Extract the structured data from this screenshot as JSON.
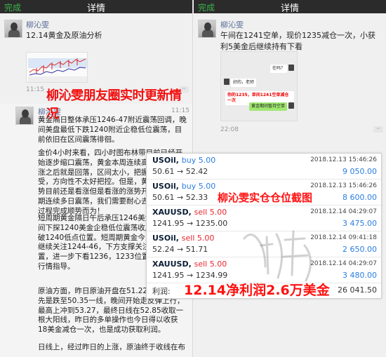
{
  "left_pane": {
    "nav": {
      "done": "完成",
      "title": "详情"
    },
    "post1": {
      "author": "柳沁雯",
      "text": "12.14黄金及原油分析",
      "time": "11:15"
    },
    "banner": "柳沁雯朋友圈实时更新情况",
    "post2": {
      "author": "柳沁雯",
      "time": "11:15",
      "paragraphs": [
        "黄金隔日整体承压1246-47附近震荡回调，晚间美盘最低下跌1240附近企稳低位震荡，目前依旧在区间震荡徘徊。",
        "金价4小时来看，四小时图布林带目前已经开始逐步缩口震荡，黄金本周连续高位小回，小涨之后就是回落，区间太小，把握起来比较难受，方向性不太好把控。但是，黄金就中期走势目前还是看涨但是看涨的涨势开始放缓，短期连续多日震荡，我们需要耐心去等候，等待过程完成顺势而为！",
        "短周期黄金隔日午后承压1246美金回落，晚间下探1240美金企稳低位震荡收尾。昨日回破1240低点位置。短周期黄金今日1233-35继续关注1244-46，下方支撑关注1240位置，进一步下看1236，1233位置，具体根据行情指导。",
        "原油方面，昨日原油开盘在51.22，价格最低先是跌至50.35一线，晚间开始走反弹上行，最高上冲到53.27，最终日线在52.85收取一根大阳线，昨日的多单操作也今日得以收获18美金减仓一次，也是成功获取利润。",
        "日线上，经过昨日的上涨，原油终于收线在布"
      ]
    }
  },
  "right_pane": {
    "nav": {
      "done": "完成",
      "title": "详情"
    },
    "post": {
      "author": "柳沁雯",
      "text": "午间在1241空单，现价1235减仓一次，小获利5美金后继续持有下看",
      "time": "22:08"
    },
    "chat_screenshot": {
      "bubble_right": "在吗？",
      "bubble_left": "好的，老师",
      "bubble_red": "你的1235，单间1241空单减仓一次",
      "bubble_green": "黄金期间暂持空单"
    }
  },
  "positions": {
    "title_overlay": "柳沁雯实仓仓位截图",
    "rows": [
      {
        "symbol": "USOil,",
        "side": "buy",
        "side_type": "buy",
        "lots": "5.00",
        "open": "50.61",
        "close": "52.42",
        "date": "2018.12.13 15:46:26",
        "profit": "9 050.00"
      },
      {
        "symbol": "USOil,",
        "side": "buy",
        "side_type": "buy",
        "lots": "5.00",
        "open": "50.61",
        "close": "52.33",
        "date": "2018.12.13 15:46:26",
        "profit": "8 600.00"
      },
      {
        "symbol": "XAUUSD,",
        "side": "sell",
        "side_type": "sell",
        "lots": "5.00",
        "open": "1241.95",
        "close": "1235.00",
        "date": "2018.12.14 04:29:07",
        "profit": "3 475.00"
      },
      {
        "symbol": "USOil,",
        "side": "sell",
        "side_type": "sell",
        "lots": "5.00",
        "open": "52.24",
        "close": "51.71",
        "date": "2018.12.14 09:41:18",
        "profit": "2 650.00"
      },
      {
        "symbol": "XAUUSD,",
        "side": "sell",
        "side_type": "sell",
        "lots": "5.00",
        "open": "1241.95",
        "close": "1234.99",
        "date": "2018.12.14 04:29:07",
        "profit": "3 480.00"
      }
    ],
    "arrow": "→",
    "footer_label": "利润:",
    "footer_value": "26 041.50",
    "profit_overlay": "12.14净利润2.6万美金"
  },
  "colors": {
    "buy": "#2a7de1",
    "sell": "#e8272c",
    "banner_red": "#f20f0f",
    "wechat_link": "#576b95",
    "nav_green": "#3bb54a"
  }
}
